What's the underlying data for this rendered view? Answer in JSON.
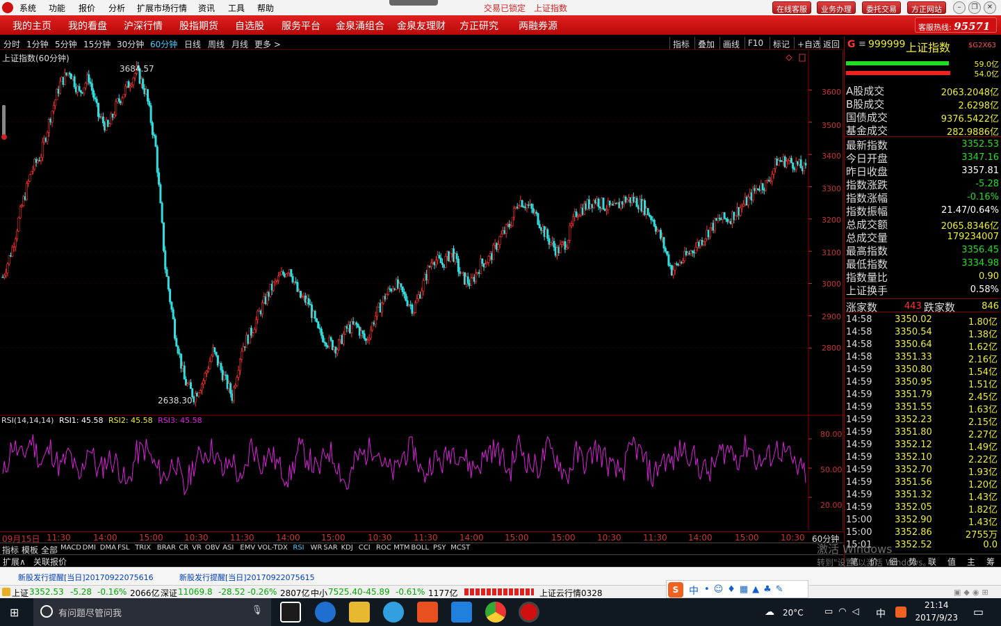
{
  "menu": [
    "系统",
    "功能",
    "报价",
    "分析",
    "扩展市场行情",
    "资讯",
    "工具",
    "帮助"
  ],
  "title_status": {
    "locked": "交易已锁定",
    "name": "上证指数"
  },
  "top_buttons": [
    "在线客服",
    "业务办理",
    "委托交易",
    "方正网站"
  ],
  "nav": [
    "我的主页",
    "我的看盘",
    "沪深行情",
    "股指期货",
    "自选股",
    "服务平台",
    "金泉涌组合",
    "金泉友理财",
    "方正研究",
    "两融券源"
  ],
  "hotline": {
    "label": "客服热线:",
    "number": "95571"
  },
  "periods": [
    "分时",
    "1分钟",
    "5分钟",
    "15分钟",
    "30分钟",
    "60分钟",
    "日线",
    "周线",
    "月线",
    "更多 >"
  ],
  "active_period": "60分钟",
  "tools": [
    "指标",
    "叠加",
    "画线",
    "F10",
    "标记",
    "+自选",
    "返回"
  ],
  "chart_title": "上证指数(60分钟)",
  "high_label": "3684.57",
  "low_label": "2638.30",
  "price_axis": [
    "3600",
    "3500",
    "3400",
    "3300",
    "3200",
    "3100",
    "3000",
    "2900",
    "2800"
  ],
  "rsi_header": {
    "label": "RSI(14,14,14)",
    "rsi1": "RSI1: 45.58",
    "rsi2": "RSI2: 45.58",
    "rsi3": "RSI3: 45.58"
  },
  "rsi_axis": [
    "80.00",
    "50.00",
    "20.00"
  ],
  "x_axis": [
    "09月15日",
    "11:30",
    "14:00",
    "15:00",
    "10:30",
    "11:30",
    "14:00",
    "15:00",
    "10:30",
    "11:30",
    "14:00",
    "15:00",
    "15:00",
    "10:30",
    "11:30",
    "14:00",
    "15:00",
    "10:30"
  ],
  "x_axis_end": "60分钟",
  "indicators": [
    "指标",
    "模板",
    "全部",
    "MACD",
    "DMI",
    "DMA",
    "FSL",
    "TRIX",
    "BRAR",
    "CR",
    "VR",
    "OBV",
    "ASI",
    "EMV",
    "VOL-TDX",
    "RSI",
    "WR",
    "SAR",
    "KDJ",
    "CCI",
    "ROC",
    "MTM",
    "BOLL",
    "PSY",
    "MCST"
  ],
  "active_indicator": "RSI",
  "ext_tabs": [
    "扩展∧",
    "关联报价"
  ],
  "stock": {
    "code": "999999",
    "name": "上证指数",
    "tag": "$G2X63",
    "bar1": "59.0亿",
    "bar2": "54.0亿"
  },
  "turnover": [
    {
      "k": "A股成交",
      "v": "2063.2048亿"
    },
    {
      "k": "B股成交",
      "v": "2.6298亿"
    },
    {
      "k": "国债成交",
      "v": "9376.5422亿"
    },
    {
      "k": "基金成交",
      "v": "282.9886亿"
    }
  ],
  "stats": [
    {
      "k": "最新指数",
      "v": "3352.53",
      "c": "#2d2"
    },
    {
      "k": "今日开盘",
      "v": "3347.16",
      "c": "#2d2"
    },
    {
      "k": "昨日收盘",
      "v": "3357.81",
      "c": "#fff"
    },
    {
      "k": "指数涨跌",
      "v": "-5.28",
      "c": "#2d2"
    },
    {
      "k": "指数涨幅",
      "v": "-0.16%",
      "c": "#2d2"
    },
    {
      "k": "指数振幅",
      "v": "21.47/0.64%",
      "c": "#fff"
    },
    {
      "k": "总成交额",
      "v": "2065.8346亿",
      "c": "#ee3"
    },
    {
      "k": "总成交量",
      "v": "179234007",
      "c": "#ee3"
    },
    {
      "k": "最高指数",
      "v": "3356.45",
      "c": "#2d2"
    },
    {
      "k": "最低指数",
      "v": "3334.98",
      "c": "#2d2"
    },
    {
      "k": "指数量比",
      "v": "0.90",
      "c": "#ee3"
    },
    {
      "k": "上证换手",
      "v": "0.58%",
      "c": "#fff"
    }
  ],
  "breadth": {
    "up_label": "涨家数",
    "up": "443",
    "down_label": "跌家数",
    "down": "846"
  },
  "ticks": [
    {
      "t": "14:58",
      "p": "3350.02",
      "v": "1.80亿"
    },
    {
      "t": "14:58",
      "p": "3350.54",
      "v": "1.38亿"
    },
    {
      "t": "14:58",
      "p": "3350.64",
      "v": "1.62亿"
    },
    {
      "t": "14:58",
      "p": "3351.33",
      "v": "2.16亿"
    },
    {
      "t": "14:59",
      "p": "3350.80",
      "v": "1.54亿"
    },
    {
      "t": "14:59",
      "p": "3350.95",
      "v": "1.51亿"
    },
    {
      "t": "14:59",
      "p": "3351.79",
      "v": "2.45亿"
    },
    {
      "t": "14:59",
      "p": "3351.55",
      "v": "1.63亿"
    },
    {
      "t": "14:59",
      "p": "3352.23",
      "v": "2.15亿"
    },
    {
      "t": "14:59",
      "p": "3351.80",
      "v": "2.27亿"
    },
    {
      "t": "14:59",
      "p": "3352.12",
      "v": "1.49亿"
    },
    {
      "t": "14:59",
      "p": "3352.10",
      "v": "2.22亿"
    },
    {
      "t": "14:59",
      "p": "3352.70",
      "v": "1.93亿"
    },
    {
      "t": "14:59",
      "p": "3351.56",
      "v": "1.20亿"
    },
    {
      "t": "14:59",
      "p": "3351.32",
      "v": "1.43亿"
    },
    {
      "t": "14:59",
      "p": "3352.05",
      "v": "1.82亿"
    },
    {
      "t": "15:00",
      "p": "3352.90",
      "v": "1.43亿"
    },
    {
      "t": "15:00",
      "p": "3352.86",
      "v": "2755万"
    },
    {
      "t": "15:01",
      "p": "3352.52",
      "v": "0.0"
    }
  ],
  "right_tabs": [
    "笔",
    "价",
    "细",
    "势",
    "联",
    "值",
    "主",
    "筹"
  ],
  "watermark": {
    "line1": "激活 Windows",
    "line2": "转到\"设置\"以激活 Windows。"
  },
  "news": [
    "新股发行提醒[当日]20170922075616",
    "新股发行提醒[当日]20170922075615"
  ],
  "quotes": [
    {
      "name": "上证",
      "price": "3352.53",
      "chg": "-5.28",
      "pct": "-0.16%",
      "amt": "2066亿"
    },
    {
      "name": "深证",
      "price": "11069.8",
      "chg": "-28.52",
      "pct": "-0.26%",
      "amt": "2807亿"
    },
    {
      "name": "中小",
      "price": "7525.40",
      "chg": "-45.89",
      "pct": "-0.61%",
      "amt": "1177亿"
    }
  ],
  "cloud": "上证云行情0328",
  "taskbar": {
    "search": "有问题尽管问我",
    "weather": "20°C",
    "ime": "中",
    "time": "21:14",
    "date": "2017/9/23"
  },
  "colors": {
    "up": "#ff3030",
    "down": "#30e0e0",
    "rsi": "#e020e0",
    "axis": "#c33"
  },
  "chart_data": {
    "type": "line",
    "title": "上证指数(60分钟)",
    "ylim": [
      2600,
      3700
    ],
    "series": [
      {
        "values": [
          3020,
          3110,
          3240,
          3350,
          3400,
          3520,
          3620,
          3660,
          3590,
          3640,
          3520,
          3480,
          3560,
          3610,
          3660,
          3590,
          3420,
          3050,
          2850,
          2700,
          2650,
          2700,
          2790,
          2720,
          2650,
          2800,
          2850,
          2920,
          2980,
          3020,
          3050,
          2960,
          2940,
          2850,
          2820,
          2800,
          2860,
          2870,
          2820,
          2900,
          2960,
          3000,
          2960,
          2920,
          3000,
          3080,
          3060,
          3100,
          3020,
          3000,
          3060,
          3080,
          3140,
          3180,
          3260,
          3240,
          3200,
          3140,
          3100,
          3130,
          3220,
          3240,
          3260,
          3240,
          3230,
          3260,
          3260,
          3240,
          3200,
          3130,
          3040,
          3070,
          3100,
          3130,
          3170,
          3200,
          3200,
          3230,
          3260,
          3300,
          3310,
          3380,
          3380,
          3370,
          3352
        ]
      }
    ],
    "rsi": [
      40,
      75,
      60,
      80,
      55,
      70,
      50,
      65,
      35,
      75,
      45,
      60,
      55,
      30,
      65,
      70,
      50,
      40,
      60,
      25,
      55,
      65,
      70,
      45,
      60,
      30,
      75,
      55,
      65,
      50,
      40,
      70,
      60,
      45,
      70,
      55,
      30,
      60,
      65,
      75,
      50,
      45,
      65,
      70,
      40,
      60,
      55,
      70,
      65,
      50,
      55,
      70,
      65,
      45,
      75,
      55,
      50,
      70,
      60,
      40,
      65,
      55,
      70,
      60,
      45,
      50,
      75,
      60,
      40,
      60,
      55,
      70,
      65,
      50,
      45,
      65,
      70,
      60,
      75,
      55,
      60,
      70,
      65,
      50,
      45
    ],
    "price_ticks": [
      3600,
      3500,
      3400,
      3300,
      3200,
      3100,
      3000,
      2900,
      2800
    ],
    "rsi_ticks": [
      80,
      50,
      20
    ]
  }
}
